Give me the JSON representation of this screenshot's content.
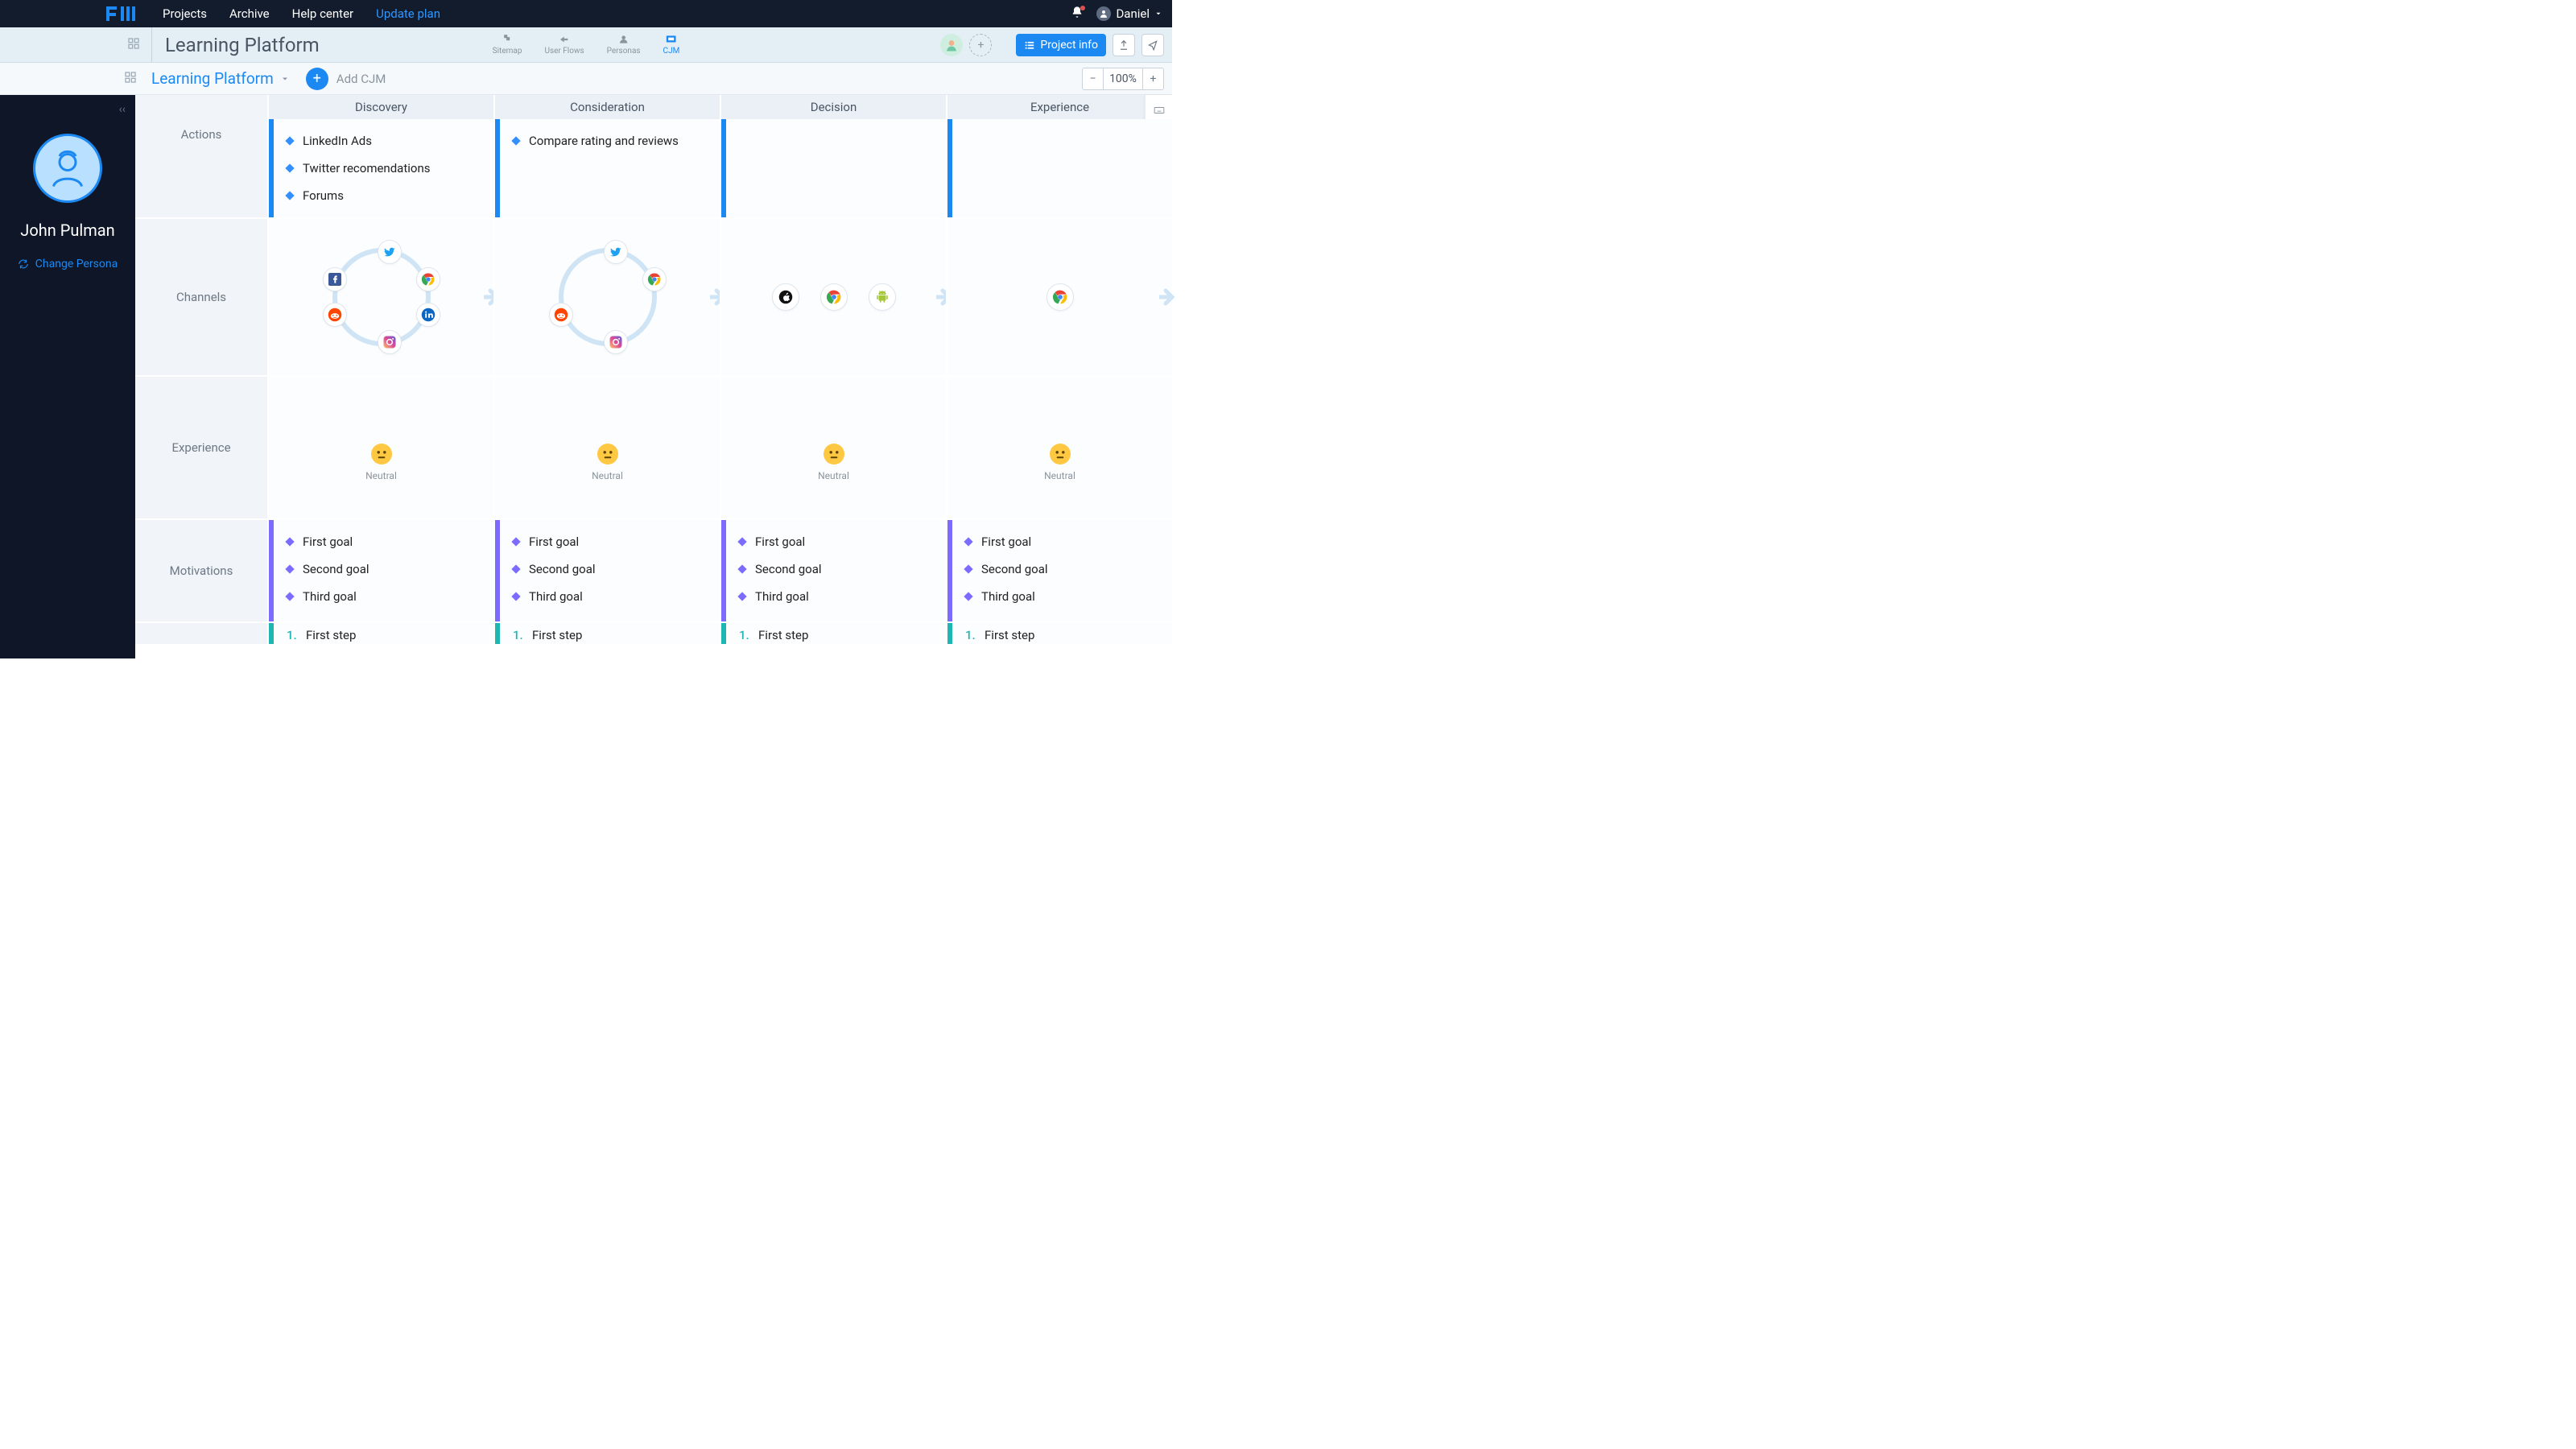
{
  "topnav": {
    "projects": "Projects",
    "archive": "Archive",
    "help": "Help center",
    "update": "Update plan",
    "username": "Daniel"
  },
  "workspace": {
    "title": "Learning Platform",
    "tabs": {
      "sitemap": "Sitemap",
      "userflows": "User Flows",
      "personas": "Personas",
      "cjm": "CJM"
    },
    "project_info": "Project info"
  },
  "toolbar": {
    "breadcrumb": "Learning Platform",
    "add_label": "Add CJM",
    "zoom": "100%"
  },
  "persona_panel": {
    "name": "John Pulman",
    "change": "Change Persona"
  },
  "stages": [
    "Discovery",
    "Consideration",
    "Decision",
    "Experience"
  ],
  "row_labels": {
    "actions": "Actions",
    "channels": "Channels",
    "experience": "Experience",
    "motivations": "Motivations"
  },
  "actions": {
    "discovery": [
      "LinkedIn Ads",
      "Twitter recomendations",
      "Forums"
    ],
    "consideration": [
      "Compare rating and reviews"
    ]
  },
  "experience_labels": [
    "Neutral",
    "Neutral",
    "Neutral",
    "Neutral"
  ],
  "motivations": [
    "First goal",
    "Second goal",
    "Third goal"
  ],
  "next_row_item": "First step"
}
